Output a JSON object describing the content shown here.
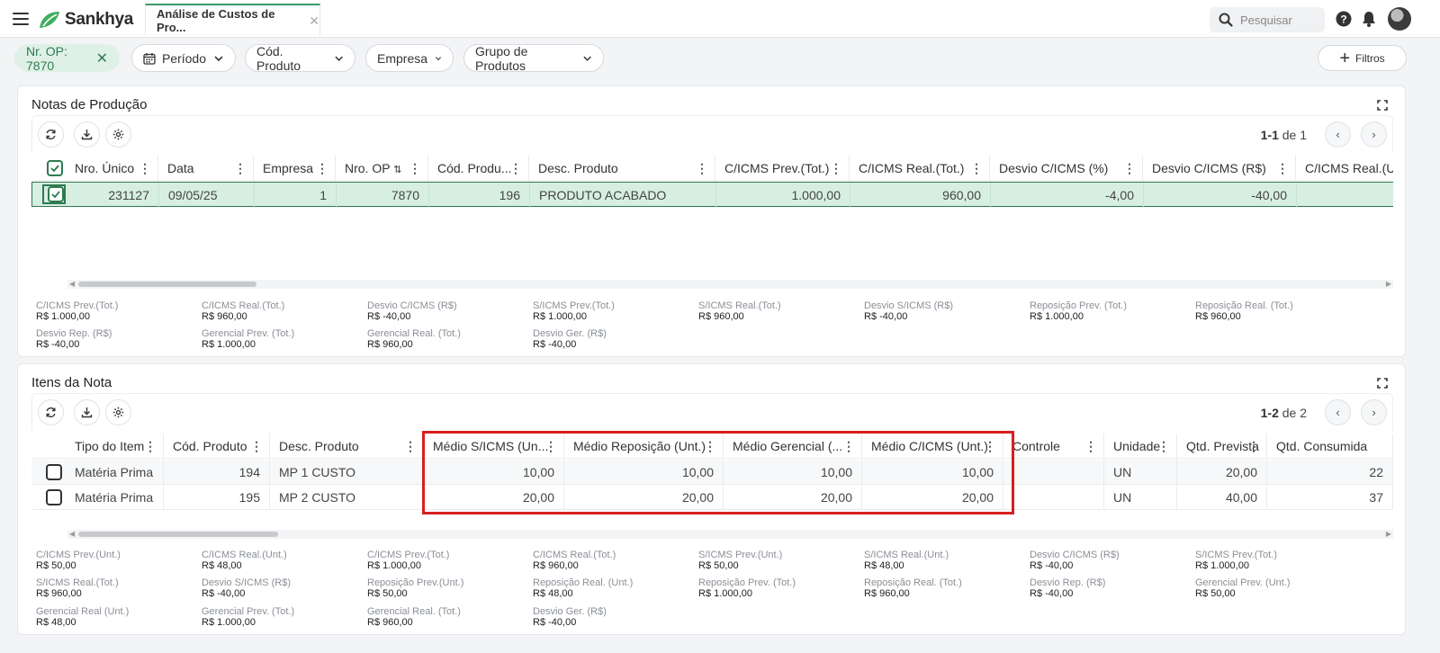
{
  "app": {
    "name": "Sankhya",
    "tab_label": "Análise de Custos de Pro...",
    "search_placeholder": "Pesquisar"
  },
  "filters": {
    "active": "Nr. OP: 7870",
    "items": [
      "Período",
      "Cód. Produto",
      "Empresa",
      "Grupo de Produtos"
    ],
    "filtros_label": "Filtros"
  },
  "notas": {
    "title": "Notas de Produção",
    "pager": {
      "range": "1-1",
      "of": "de 1"
    },
    "columns": [
      "Nro. Único",
      "Data",
      "Empresa",
      "Nro. OP",
      "Cód. Produ...",
      "Desc. Produto",
      "C/ICMS Prev.(Tot.)",
      "C/ICMS Real.(Tot.)",
      "Desvio C/ICMS (%)",
      "Desvio C/ICMS (R$)",
      "C/ICMS Real.(U"
    ],
    "rows": [
      [
        "231127",
        "09/05/25",
        "1",
        "7870",
        "196",
        "PRODUTO ACABADO",
        "1.000,00",
        "960,00",
        "-4,00",
        "-40,00",
        ""
      ]
    ],
    "totals": [
      {
        "label": "C/ICMS Prev.(Tot.)",
        "value": "R$ 1.000,00"
      },
      {
        "label": "C/ICMS Real.(Tot.)",
        "value": "R$ 960,00"
      },
      {
        "label": "Desvio C/ICMS (R$)",
        "value": "R$ -40,00"
      },
      {
        "label": "S/ICMS Prev.(Tot.)",
        "value": "R$ 1.000,00"
      },
      {
        "label": "S/ICMS Real.(Tot.)",
        "value": "R$ 960,00"
      },
      {
        "label": "Desvio S/ICMS (R$)",
        "value": "R$ -40,00"
      },
      {
        "label": "Reposição Prev. (Tot.)",
        "value": "R$ 1.000,00"
      },
      {
        "label": "Reposição Real. (Tot.)",
        "value": "R$ 960,00"
      },
      {
        "label": "Desvio Rep. (R$)",
        "value": "R$ -40,00"
      },
      {
        "label": "Gerencial Prev. (Tot.)",
        "value": "R$ 1.000,00"
      },
      {
        "label": "Gerencial Real. (Tot.)",
        "value": "R$ 960,00"
      },
      {
        "label": "Desvio Ger. (R$)",
        "value": "R$ -40,00"
      }
    ]
  },
  "itens": {
    "title": "Itens da Nota",
    "pager": {
      "range": "1-2",
      "of": "de 2"
    },
    "columns": [
      "Tipo do Item",
      "Cód. Produto",
      "Desc. Produto",
      "Médio S/ICMS (Un...",
      "Médio Reposição (Unt.)",
      "Médio Gerencial (...",
      "Médio C/ICMS (Unt.)",
      "Controle",
      "Unidade",
      "Qtd. Prevista",
      "Qtd. Consumida"
    ],
    "rows": [
      [
        "Matéria Prima",
        "194",
        "MP 1 CUSTO",
        "10,00",
        "10,00",
        "10,00",
        "10,00",
        "",
        "UN",
        "20,00",
        "22"
      ],
      [
        "Matéria Prima",
        "195",
        "MP 2 CUSTO",
        "20,00",
        "20,00",
        "20,00",
        "20,00",
        "",
        "UN",
        "40,00",
        "37"
      ]
    ],
    "totals": [
      {
        "label": "C/ICMS Prev.(Unt.)",
        "value": "R$ 50,00"
      },
      {
        "label": "C/ICMS Real.(Unt.)",
        "value": "R$ 48,00"
      },
      {
        "label": "C/ICMS Prev.(Tot.)",
        "value": "R$ 1.000,00"
      },
      {
        "label": "C/ICMS Real.(Tot.)",
        "value": "R$ 960,00"
      },
      {
        "label": "S/ICMS Prev.(Unt.)",
        "value": "R$ 50,00"
      },
      {
        "label": "S/ICMS Real.(Unt.)",
        "value": "R$ 48,00"
      },
      {
        "label": "Desvio C/ICMS (R$)",
        "value": "R$ -40,00"
      },
      {
        "label": "S/ICMS Prev.(Tot.)",
        "value": "R$ 1.000,00"
      },
      {
        "label": "S/ICMS Real.(Tot.)",
        "value": "R$ 960,00"
      },
      {
        "label": "Desvio S/ICMS (R$)",
        "value": "R$ -40,00"
      },
      {
        "label": "Reposição Prev.(Unt.)",
        "value": "R$ 50,00"
      },
      {
        "label": "Reposição Real. (Unt.)",
        "value": "R$ 48,00"
      },
      {
        "label": "Reposição Prev. (Tot.)",
        "value": "R$ 1.000,00"
      },
      {
        "label": "Reposição Real. (Tot.)",
        "value": "R$ 960,00"
      },
      {
        "label": "Desvio Rep. (R$)",
        "value": "R$ -40,00"
      },
      {
        "label": "Gerencial Prev. (Unt.)",
        "value": "R$ 50,00"
      },
      {
        "label": "Gerencial Real (Unt.)",
        "value": "R$ 48,00"
      },
      {
        "label": "Gerencial Prev. (Tot.)",
        "value": "R$ 1.000,00"
      },
      {
        "label": "Gerencial Real. (Tot.)",
        "value": "R$ 960,00"
      },
      {
        "label": "Desvio Ger. (R$)",
        "value": "R$ -40,00"
      }
    ]
  },
  "colors": {
    "accent": "#3a9b66",
    "selected_row": "#d7efe1",
    "highlight": "#d81f1f"
  }
}
